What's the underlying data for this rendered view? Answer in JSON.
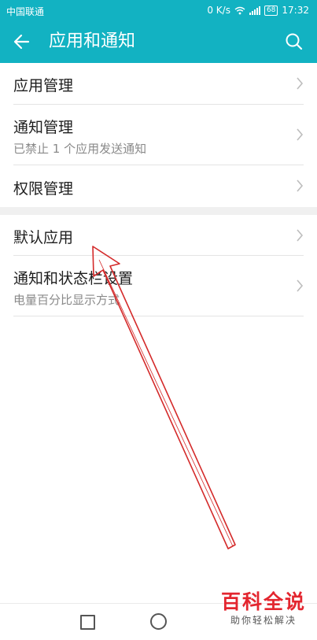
{
  "status_bar": {
    "carrier": "中国联通",
    "speed": "0 K/s",
    "battery": "68",
    "time": "17:32"
  },
  "header": {
    "title": "应用和通知",
    "back_icon": "arrow-left-icon",
    "search_icon": "search-icon"
  },
  "list": {
    "items": [
      {
        "title": "应用管理"
      },
      {
        "title": "通知管理",
        "subtitle": "已禁止 1 个应用发送通知"
      },
      {
        "title": "权限管理"
      },
      {
        "title": "默认应用"
      },
      {
        "title": "通知和状态栏设置",
        "subtitle": "电量百分比显示方式"
      }
    ]
  },
  "watermark": {
    "main": "百科全说",
    "sub": "助你轻松解决"
  },
  "colors": {
    "accent": "#12b2c2",
    "annotation_arrow": "#d42a2a"
  }
}
